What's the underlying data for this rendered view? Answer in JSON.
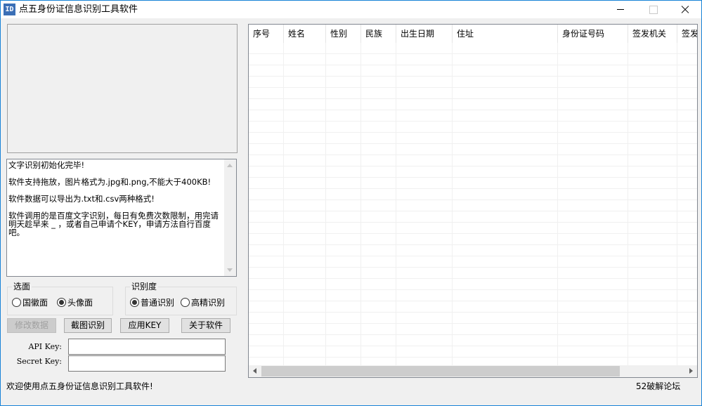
{
  "window": {
    "title": "点五身份证信息识别工具软件",
    "icon_text": "ID",
    "border_color": "#1883d7",
    "controls": [
      "minimize-icon",
      "maximize-icon",
      "close-icon"
    ]
  },
  "log": {
    "lines": [
      "文字识别初始化完毕!",
      "",
      "软件支持拖放，图片格式为.jpg和.png,不能大于400KB!",
      "",
      "软件数据可以导出为.txt和.csv两种格式!",
      "",
      "软件调用的是百度文字识别，每日有免费次数限制，用完请明天趁早来 _ ，或者自己申请个KEY，申请方法自行百度吧。"
    ]
  },
  "side_selector": {
    "legend": "选面",
    "options": [
      {
        "label": "国徽面",
        "checked": false
      },
      {
        "label": "头像面",
        "checked": true
      }
    ]
  },
  "accuracy_selector": {
    "legend": "识别度",
    "options": [
      {
        "label": "普通识别",
        "checked": true
      },
      {
        "label": "高精识别",
        "checked": false
      }
    ]
  },
  "buttons": {
    "modify": "修改数据",
    "screenshot": "截图识别",
    "apply_key": "应用KEY",
    "about": "关于软件"
  },
  "keys": {
    "api_label": "API Key:",
    "api_value": "",
    "secret_label": "Secret Key:",
    "secret_value": ""
  },
  "grid": {
    "columns": [
      "序号",
      "姓名",
      "性别",
      "民族",
      "出生日期",
      "住址",
      "身份证号码",
      "签发机关",
      "签发"
    ],
    "rows": []
  },
  "status": {
    "left": "欢迎使用点五身份证信息识别工具软件!",
    "right": "52破解论坛"
  }
}
